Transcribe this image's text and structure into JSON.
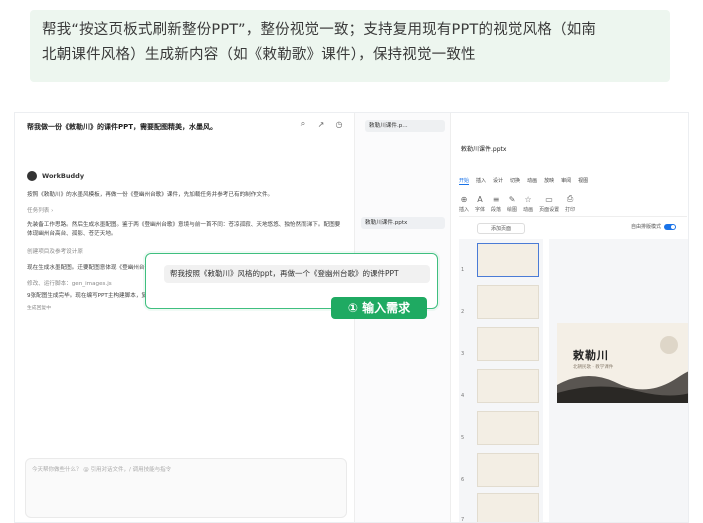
{
  "caption": {
    "line1": "帮我“按这页板式刷新整份PPT”，整份视觉一致；支持复用现有PPT的视觉风格（如南",
    "line2": "北朝课件风格）生成新内容（如《敕勒歌》课件），保持视觉一致性"
  },
  "chat": {
    "title": "帮我做一份《敕勒川》的课件PPT，需要配图精美，水墨风。",
    "bot_name": "WorkBuddy",
    "msg1": "按照《敕勒川》的水墨风模板，再做一份《登幽州台歌》课件，先加载任务并参考已有的制作文件。",
    "task_list": "任务列表 ›",
    "msg2": "先装备工作思路。然后生成水墨配图。鉴于两《登幽州台歌》意境与前一首不同：苍凉孤寂、天地悠悠、独怆然而涕下。配图要体现幽州台高台、孤影、苍茫天地。",
    "step1": "创建项目及参考设计原",
    "msg3": "现在生成水墨配图。迁要配图意体现《登幽州台歌》的苍凉孤寂：高台、孤影、天地悠悠、古人来者无踪。",
    "step2": "修改、运行脚本：gen_images.js",
    "msg4": "9张配图生成完毕。现在编写PPT主构建脚本，复用《敕勒川》的设计体系，内容适配《登幽州台歌》。",
    "status": "生成回复中",
    "input_placeholder": "今天帮你做些什么？ @ 引用对话文件，/ 调用技能与指令"
  },
  "bubble": {
    "text": "帮我按照《敕勒川》风格的ppt，再做一个《登幽州台歌》的课件PPT"
  },
  "step_badge": "① 输入需求",
  "files": {
    "tab": "敕勒川课件.p...",
    "item": "敕勒川课件.pptx"
  },
  "ppt": {
    "file_name": "敕勒川课件.pptx",
    "menu": [
      "开始",
      "插入",
      "设计",
      "切换",
      "动画",
      "放映",
      "审阅",
      "视图"
    ],
    "ribbon": [
      "插入",
      "字体",
      "段落",
      "绘图",
      "动画",
      "页面设置",
      "打印"
    ],
    "add_page": "添加页面",
    "smart_toggle": "自由排版模式",
    "slide_title": "敕勒川",
    "slide_subtitle": "北朝民歌 · 教学课件",
    "thumb_numbers": [
      "1",
      "2",
      "3",
      "4",
      "5",
      "6",
      "7"
    ]
  },
  "colors": {
    "caption_bg": "#edf6ef",
    "accent_green": "#1faa62",
    "accent_blue": "#1a73e8",
    "seal_red": "#b0312a"
  }
}
